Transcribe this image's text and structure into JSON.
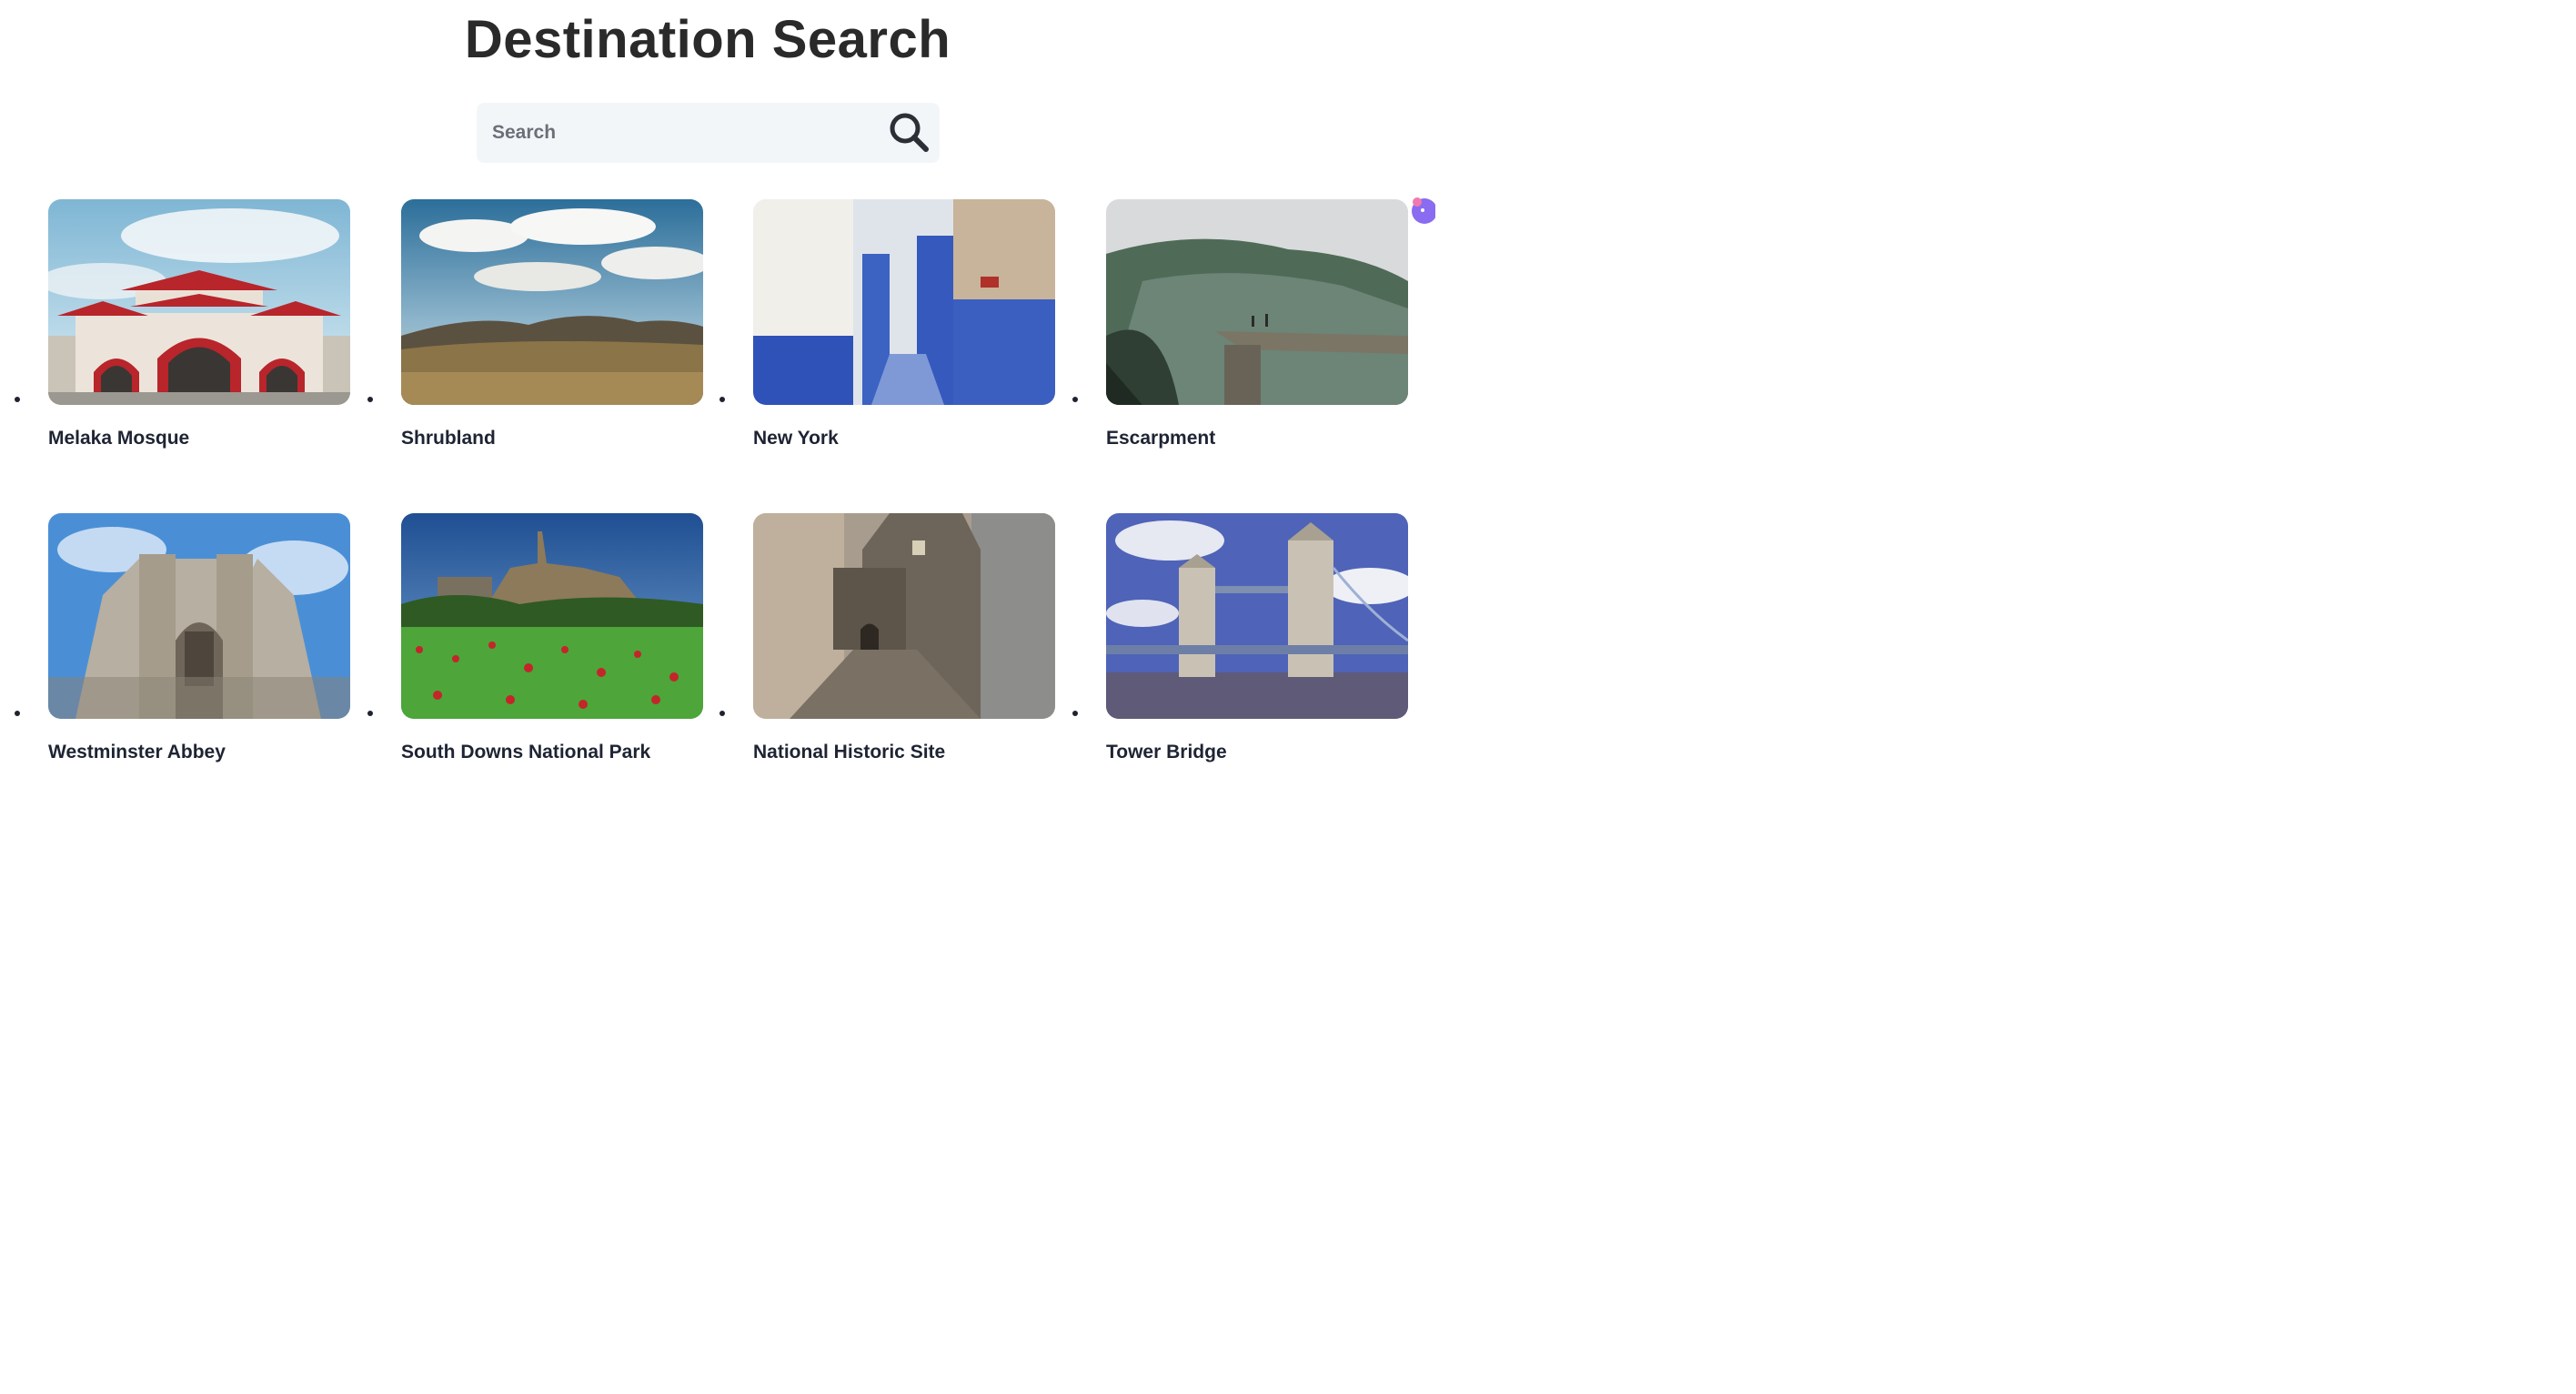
{
  "page": {
    "title": "Destination Search"
  },
  "search": {
    "placeholder": "Search",
    "value": ""
  },
  "icons": {
    "search": "search-icon"
  },
  "destinations": [
    {
      "name": "Melaka Mosque"
    },
    {
      "name": "Shrubland"
    },
    {
      "name": "New York"
    },
    {
      "name": "Escarpment"
    },
    {
      "name": "Westminster Abbey"
    },
    {
      "name": "South Downs National Park"
    },
    {
      "name": "National Historic Site"
    },
    {
      "name": "Tower Bridge"
    }
  ]
}
